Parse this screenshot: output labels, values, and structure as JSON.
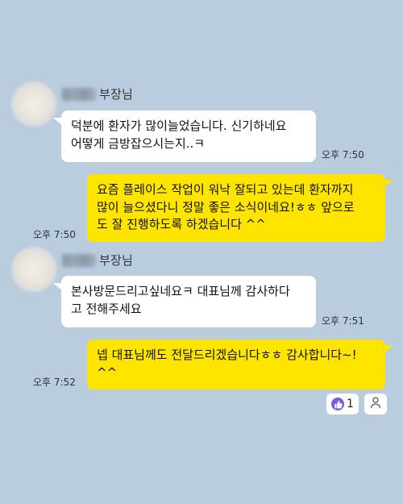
{
  "messages": [
    {
      "sender": "부장님",
      "text": "덕분에 환자가 많이늘었습니다. 신기하네요\n어떻게 금방잡으시는지..ㅋ",
      "time": "오후 7:50"
    },
    {
      "text": "요즘 플레이스 작업이 워낙 잘되고 있는데 환자까지\n많이 늘으셨다니 정말 좋은 소식이네요!ㅎㅎ 앞으로\n도 잘 진행하도록 하겠습니다 ^^",
      "time": "오후 7:50"
    },
    {
      "sender": "부장님",
      "text": "본사방문드리고싶네요ㅋ 대표님께 감사하다\n고 전해주세요",
      "time": "오후 7:51"
    },
    {
      "text": "넵 대표님께도 전달드리겠습니다ㅎㅎ 감사합니다~!\n^^",
      "time": "오후 7:52"
    }
  ],
  "reactions": {
    "like_count": "1",
    "like_icon": "thumbs-up-icon",
    "add_icon": "person-icon"
  },
  "colors": {
    "background": "#b9cddf",
    "my_bubble": "#fee500",
    "their_bubble": "#ffffff",
    "reaction_accent": "#7a5ae0"
  }
}
